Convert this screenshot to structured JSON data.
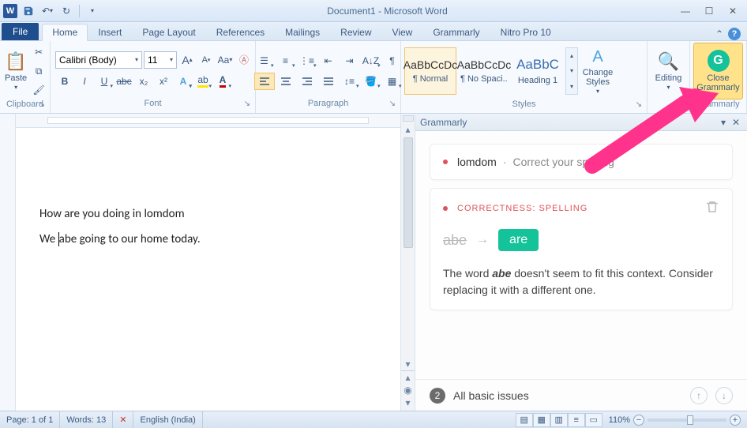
{
  "title": "Document1 - Microsoft Word",
  "qat": {
    "save": "save-icon",
    "undo": "undo-icon",
    "redo": "redo-icon"
  },
  "tabs": {
    "file": "File",
    "items": [
      "Home",
      "Insert",
      "Page Layout",
      "References",
      "Mailings",
      "Review",
      "View",
      "Grammarly",
      "Nitro Pro 10"
    ],
    "active_index": 0
  },
  "ribbon": {
    "clipboard": {
      "label": "Clipboard",
      "paste": "Paste"
    },
    "font": {
      "label": "Font",
      "name": "Calibri (Body)",
      "size": "11",
      "buttons": {
        "bold": "B",
        "italic": "I",
        "underline": "U",
        "strike": "abc",
        "sub": "x₂",
        "sup": "x²"
      }
    },
    "paragraph": {
      "label": "Paragraph"
    },
    "styles": {
      "label": "Styles",
      "tiles": [
        {
          "preview": "AaBbCcDc",
          "name": "¶ Normal",
          "selected": true,
          "color": "#333"
        },
        {
          "preview": "AaBbCcDc",
          "name": "¶ No Spaci...",
          "selected": false,
          "color": "#333"
        },
        {
          "preview": "AaBbC",
          "name": "Heading 1",
          "selected": false,
          "color": "#3b6fb0"
        }
      ],
      "change": "Change Styles"
    },
    "editing": {
      "label": "Editing"
    },
    "grammarly": {
      "label": "Grammarly",
      "btn_line1": "Close",
      "btn_line2": "Grammarly"
    }
  },
  "document": {
    "line1": "How are you doing in lomdom",
    "line2_pre": "We ",
    "line2_word": "abe",
    "line2_post": " going to our home today."
  },
  "grammarly_pane": {
    "title": "Grammarly",
    "collapsed": {
      "word": "lomdom",
      "sep": "·",
      "hint": "Correct your spelling"
    },
    "expanded": {
      "category": "CORRECTNESS: SPELLING",
      "from": "abe",
      "to": "are",
      "desc_pre": "The word ",
      "desc_word": "abe",
      "desc_post": " doesn't seem to fit this context. Consider replacing it with a different one."
    },
    "footer": {
      "count": "2",
      "text": "All basic issues"
    }
  },
  "status": {
    "page": "Page: 1 of 1",
    "words": "Words: 13",
    "lang": "English (India)",
    "zoom_pct": "110%"
  }
}
